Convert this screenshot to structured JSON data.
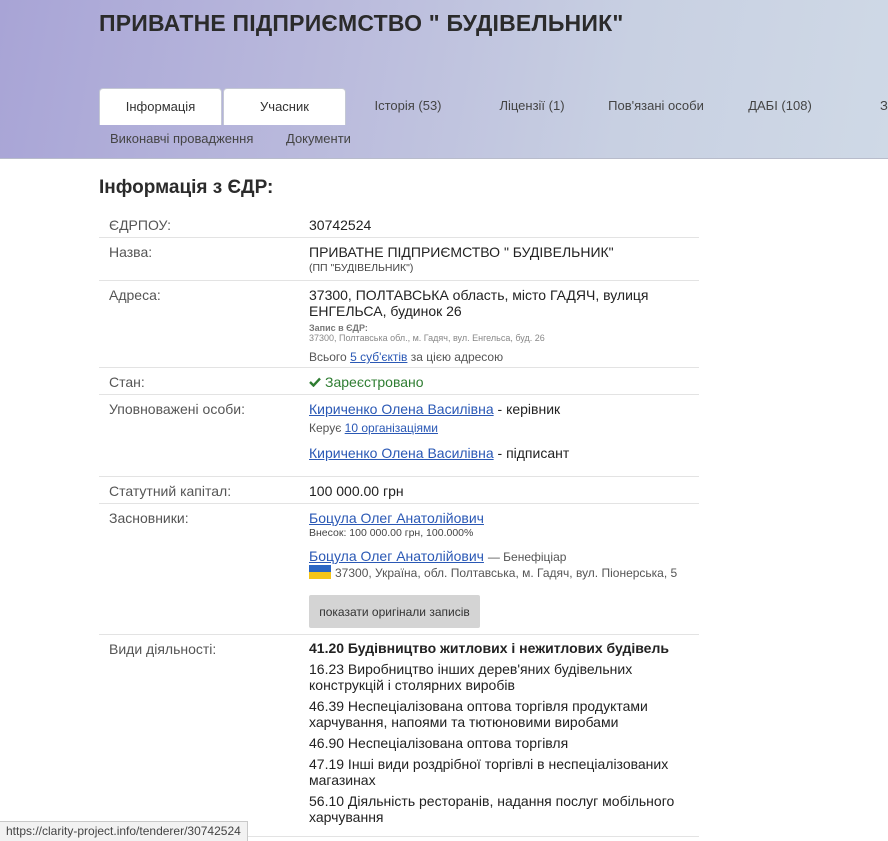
{
  "company": {
    "title": "ПРИВАТНЕ ПІДПРИЄМСТВО \" БУДІВЕЛЬНИК\""
  },
  "tabs": [
    {
      "label": "Інформація"
    },
    {
      "label": "Учасник"
    },
    {
      "label": "Історія (53)"
    },
    {
      "label": "Ліцензії (1)"
    },
    {
      "label": "Пов'язані особи"
    },
    {
      "label": "ДАБІ (108)"
    },
    {
      "label": "З"
    }
  ],
  "tabs2": [
    {
      "label": "Виконавчі провадження"
    },
    {
      "label": "Документи"
    }
  ],
  "section": {
    "title": "Інформація з ЄДР:"
  },
  "fields": {
    "edrpou": {
      "label": "ЄДРПОУ:",
      "value": "30742524"
    },
    "name": {
      "label": "Назва:",
      "value": "ПРИВАТНЕ ПІДПРИЄМСТВО \" БУДІВЕЛЬНИК\"",
      "short": "(ПП \"БУДІВЕЛЬНИК\")"
    },
    "address": {
      "label": "Адреса:",
      "value": "37300, ПОЛТАВСЬКА область, місто ГАДЯЧ, вулиця ЕНГЕЛЬСА, будинок 26",
      "record_label": "Запис в ЄДР:",
      "record_value": "37300, Полтавська обл., м. Гадяч, вул. Енгельса, буд. 26",
      "total_prefix": "Всього",
      "total_link": "5 суб'єктів",
      "total_suffix": "за цією адресою"
    },
    "state": {
      "label": "Стан:",
      "value": "Зареєстровано"
    },
    "authorized": {
      "label": "Уповноважені особи:",
      "person1_name": "Кириченко Олена Василівна",
      "person1_role": "- керівник",
      "manages_prefix": "Керує",
      "manages_link": "10 організаціями",
      "person2_name": "Кириченко Олена Василівна",
      "person2_role": "- підписант"
    },
    "capital": {
      "label": "Статутний капітал:",
      "value": "100 000.00 грн"
    },
    "founders": {
      "label": "Засновники:",
      "founder1_name": "Боцула Олег Анатолійович",
      "founder1_share": "Внесок: 100 000.00 грн, 100.000%",
      "founder2_name": "Боцула Олег Анатолійович",
      "founder2_role": "— Бенефіціар",
      "founder2_address": "37300, Україна, обл. Полтавська, м. Гадяч, вул. Піонерська, 5",
      "show_button": "показати оригінали записів"
    },
    "activities": {
      "label": "Види діяльності:",
      "items": [
        "41.20 Будівництво житлових і нежитлових будівель",
        "16.23 Виробництво інших дерев'яних будівельних конструкцій і столярних виробів",
        "46.39 Неспеціалізована оптова торгівля продуктами харчування, напоями та тютюновими виробами",
        "46.90 Неспеціалізована оптова торгівля",
        "47.19 Інші види роздрібної торгівлі в неспеціалізованих магазинах",
        "56.10 Діяльність ресторанів, надання послуг мобільного харчування"
      ]
    }
  },
  "status_bar": {
    "url": "https://clarity-project.info/tenderer/30742524"
  }
}
